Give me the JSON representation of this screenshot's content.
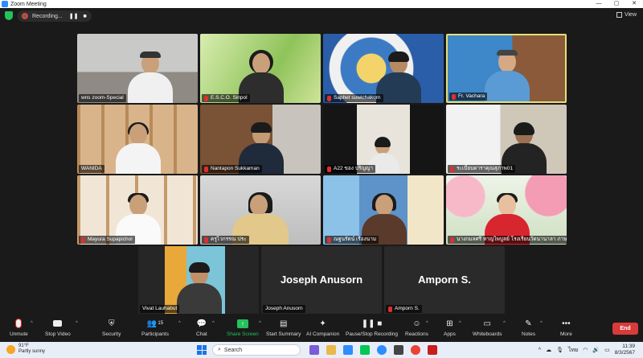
{
  "window": {
    "title": "Zoom Meeting",
    "controls": [
      "—",
      "▢",
      "✕"
    ]
  },
  "topbar": {
    "recording_label": "Recording...",
    "pause_glyph": "❚❚",
    "stop_glyph": "■",
    "view_label": "View"
  },
  "participants": [
    {
      "name": "wns zoom-Special",
      "muted": false,
      "video": true,
      "speaking": false
    },
    {
      "name": "E.S.C.O. Sinpol",
      "muted": true,
      "video": true,
      "speaking": false
    },
    {
      "name": "Saphet suwichakorn",
      "muted": true,
      "video": true,
      "speaking": false
    },
    {
      "name": "Fr. Vachara",
      "muted": true,
      "video": true,
      "speaking": true
    },
    {
      "name": "WANIDA",
      "muted": false,
      "video": true,
      "speaking": false
    },
    {
      "name": "Nantapon Sukkaman",
      "muted": true,
      "video": true,
      "speaking": false
    },
    {
      "name": "A22 ของ ปริญญา",
      "muted": true,
      "video": true,
      "speaking": false
    },
    {
      "name": "ระเบียบดาราคุณสุภาพ01",
      "muted": true,
      "video": true,
      "speaking": false
    },
    {
      "name": "Mayura Supapichol",
      "muted": true,
      "video": true,
      "speaking": false
    },
    {
      "name": "ครูไวกรรณ ประ",
      "muted": true,
      "video": true,
      "speaking": false
    },
    {
      "name": "ณฐนรัตน์ เรืองนาม",
      "muted": true,
      "video": true,
      "speaking": false
    },
    {
      "name": "นางกมลศรี หาญไพบูลย์ โรงเรียนวัดนานาลา ภาษ",
      "muted": true,
      "video": true,
      "speaking": false
    },
    {
      "name": "Vivat Lauhabut",
      "muted": false,
      "video": true,
      "speaking": false
    },
    {
      "name": "Joseph Anusorn",
      "muted": false,
      "video": false,
      "speaking": false
    },
    {
      "name": "Amporn S.",
      "muted": true,
      "video": false,
      "speaking": false
    }
  ],
  "toolbar": {
    "unmute": "Unmute",
    "stop_video": "Stop Video",
    "security": "Security",
    "participants": "Participants",
    "participants_count": "15",
    "chat": "Chat",
    "share_screen": "Share Screen",
    "start_summary": "Start Summary",
    "ai_companion": "AI Companion",
    "pause_stop_recording": "Pause/Stop Recording",
    "reactions": "Reactions",
    "apps": "Apps",
    "whiteboards": "Whiteboards",
    "notes": "Notes",
    "more": "More",
    "end": "End"
  },
  "taskbar": {
    "temperature": "91°F",
    "weather": "Partly sunny",
    "search_placeholder": "Search",
    "language": "ไทย",
    "time": "11:39",
    "date": "8/3/2567"
  },
  "colors": {
    "accent_green": "#23c25d",
    "mute_red": "#e02e2e",
    "end_red": "#d93a3a",
    "speaking_border": "#e5e07a",
    "background": "#1a1a1a"
  }
}
